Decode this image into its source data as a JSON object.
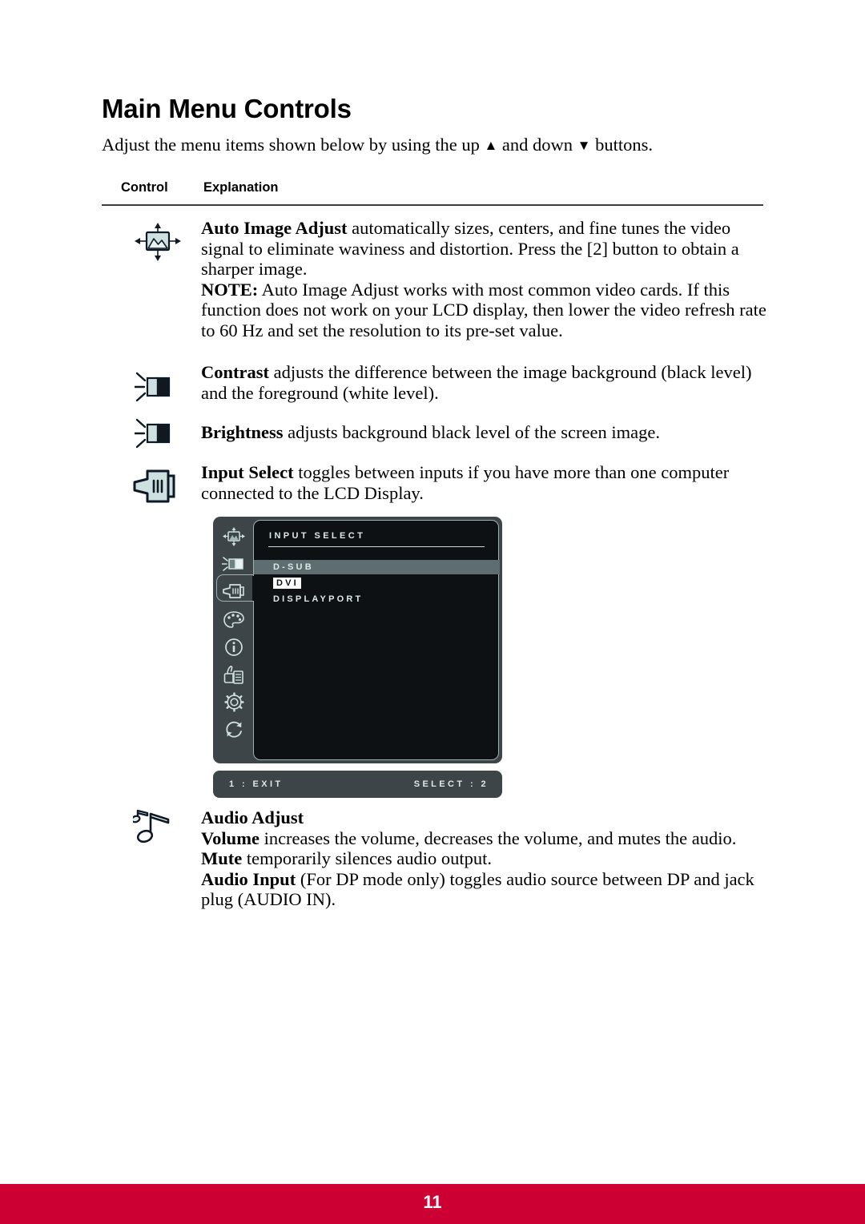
{
  "page": {
    "title": "Main Menu Controls",
    "intro_before": "Adjust the menu items shown below by using the up ",
    "intro_up_arrow": "▲",
    "intro_middle": " and down ",
    "intro_down_arrow": "▼",
    "intro_after": " buttons.",
    "footer_page_number": "11",
    "footer_color": "#CC0033"
  },
  "table": {
    "header_control": "Control",
    "header_explanation": "Explanation"
  },
  "rows": [
    {
      "icon": "auto-image-adjust-icon",
      "lines": [
        {
          "bold": "Auto Image Adjust",
          "rest": " automatically sizes, centers, and fine tunes the video signal to eliminate waviness and distortion. Press the [2] button to obtain a sharper image."
        },
        {
          "bold": "NOTE:",
          "rest": " Auto Image Adjust works with most common video cards. If this function does not work on your LCD display, then lower the video refresh rate to 60 Hz and set the resolution to its pre-set value."
        }
      ]
    },
    {
      "icon": "contrast-icon",
      "lines": [
        {
          "bold": "Contrast",
          "rest": " adjusts the difference between the image background (black level) and the foreground (white level)."
        }
      ]
    },
    {
      "icon": "brightness-icon",
      "lines": [
        {
          "bold": "Brightness",
          "rest": " adjusts background black level of the screen image."
        }
      ]
    },
    {
      "icon": "input-select-icon",
      "lines": [
        {
          "bold": "Input Select",
          "rest": " toggles between inputs if you have more than one computer connected to the LCD Display."
        }
      ]
    },
    {
      "icon": "audio-adjust-icon",
      "lines": [
        {
          "bold": "Audio Adjust",
          "rest": ""
        },
        {
          "bold": "Volume",
          "rest": " increases the volume, decreases the volume, and mutes the audio."
        },
        {
          "bold": "Mute",
          "rest": " temporarily silences audio output."
        },
        {
          "bold": "Audio Input",
          "rest": " (For DP mode only) toggles audio source between DP and jack plug (AUDIO IN)."
        }
      ]
    }
  ],
  "osd": {
    "heading": "INPUT SELECT",
    "items": [
      {
        "label": "D-SUB",
        "state": "highlighted"
      },
      {
        "label": "DVI",
        "state": "boxed"
      },
      {
        "label": "DISPLAYPORT",
        "state": "normal"
      }
    ],
    "bottom_left": "1 : EXIT",
    "bottom_right": "SELECT : 2",
    "sidebar_icons": [
      "auto-image-adjust-icon",
      "contrast-brightness-icon",
      "input-select-icon",
      "color-palette-icon",
      "information-icon",
      "manual-setup-icon",
      "setup-gear-icon",
      "memory-recall-icon"
    ],
    "selected_sidebar_index": 2,
    "panel_color": "#3D4549",
    "screen_color": "#0E1113",
    "highlight_color": "#5D6D70",
    "text_color": "#DDE8E8"
  }
}
